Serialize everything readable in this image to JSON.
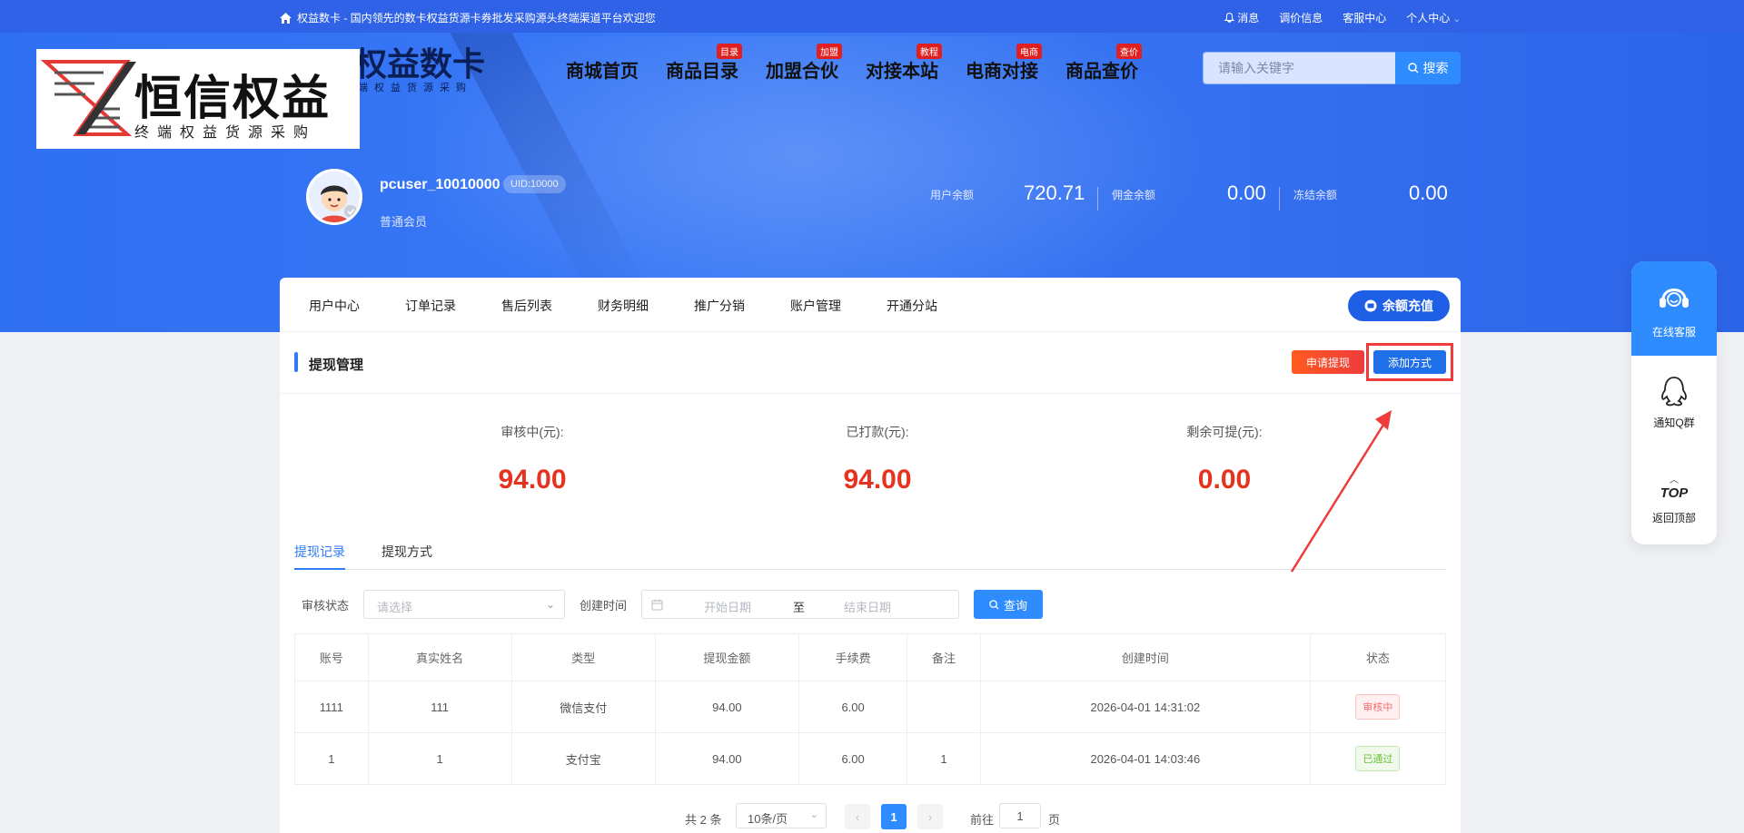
{
  "topbar": {
    "welcome": "权益数卡 - 国内领先的数卡权益货源卡券批发采购源头终端渠道平台欢迎您",
    "links": [
      "消息",
      "调价信息",
      "客服中心",
      "个人中心"
    ]
  },
  "logo": {
    "title": "恒信权益",
    "subtitle": "终端权益货源采购",
    "behind_title": "权益数卡",
    "behind_sub": "端权益货源采购"
  },
  "mainnav": [
    {
      "label": "商城首页",
      "badge": ""
    },
    {
      "label": "商品目录",
      "badge": "目录"
    },
    {
      "label": "加盟合伙",
      "badge": "加盟"
    },
    {
      "label": "对接本站",
      "badge": "教程"
    },
    {
      "label": "电商对接",
      "badge": "电商"
    },
    {
      "label": "商品查价",
      "badge": "查价"
    }
  ],
  "search": {
    "placeholder": "请输入关键字",
    "button": "搜索"
  },
  "user": {
    "name": "pcuser_10010000",
    "uid": "UID:10000",
    "level": "普通会员",
    "balances": [
      {
        "label": "用户余额",
        "value": "720.71"
      },
      {
        "label": "佣金余额",
        "value": "0.00"
      },
      {
        "label": "冻结余额",
        "value": "0.00"
      }
    ]
  },
  "tabs": [
    "用户中心",
    "订单记录",
    "售后列表",
    "财务明细",
    "推广分销",
    "账户管理",
    "开通分站"
  ],
  "recharge_label": "余额充值",
  "section": {
    "title": "提现管理",
    "apply_label": "申请提现",
    "add_label": "添加方式"
  },
  "stats": [
    {
      "label": "审核中(元):",
      "value": "94.00"
    },
    {
      "label": "已打款(元):",
      "value": "94.00"
    },
    {
      "label": "剩余可提(元):",
      "value": "0.00"
    }
  ],
  "subtabs": [
    "提现记录",
    "提现方式"
  ],
  "filter": {
    "status_label": "审核状态",
    "status_placeholder": "请选择",
    "time_label": "创建时间",
    "start_placeholder": "开始日期",
    "to": "至",
    "end_placeholder": "结束日期",
    "query": "查询"
  },
  "table": {
    "headers": [
      "账号",
      "真实姓名",
      "类型",
      "提现金额",
      "手续费",
      "备注",
      "创建时间",
      "状态"
    ],
    "rows": [
      [
        "1111",
        "111",
        "微信支付",
        "94.00",
        "6.00",
        "",
        "2026-04-01 14:31:02",
        "审核中"
      ],
      [
        "1",
        "1",
        "支付宝",
        "94.00",
        "6.00",
        "1",
        "2026-04-01 14:03:46",
        "已通过"
      ]
    ],
    "status_colors": {
      "审核中": "#f56c6c",
      "已通过": "#67c23a"
    }
  },
  "pagination": {
    "total": "共 2 条",
    "page_size": "10条/页",
    "prev": "‹",
    "current": "1",
    "next": "›",
    "goto": "前往",
    "goto_value": "1",
    "page": "页"
  },
  "float": {
    "service": "在线客服",
    "qq": "通知Q群",
    "top_icon": "TOP",
    "top": "返回顶部"
  },
  "colors": {
    "primary": "#2f8cff",
    "accent_red": "#e5331f",
    "hero_blue": "#2f6ff2"
  }
}
